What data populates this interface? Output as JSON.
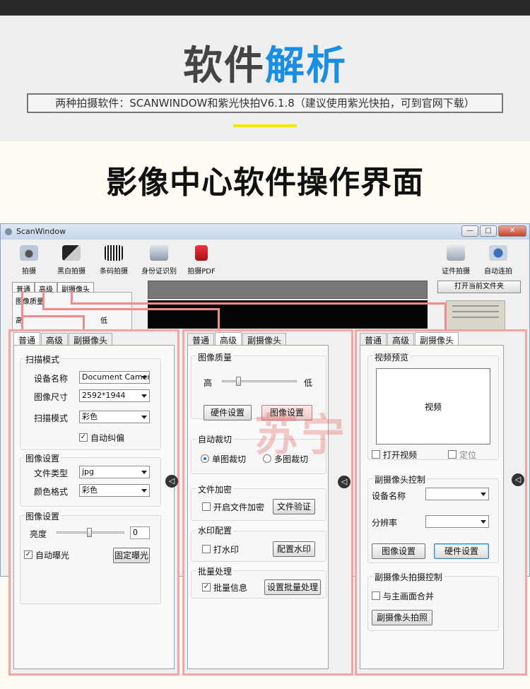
{
  "header": {
    "title_part1": "软件",
    "title_part2": "解析",
    "subtitle": "两种拍摄软件：SCANWINDOW和紫光快拍V6.1.8（建议使用紫光快拍，可到官网下载）",
    "section_title": "影像中心软件操作界面"
  },
  "app": {
    "title": "ScanWindow",
    "window_controls": [
      "—",
      "□",
      "✕"
    ],
    "tools": [
      {
        "label": "拍摄",
        "icon": "camera-icon"
      },
      {
        "label": "黑白拍摄",
        "icon": "bw-camera-icon"
      },
      {
        "label": "条码拍摄",
        "icon": "barcode-icon"
      },
      {
        "label": "身份证识别",
        "icon": "id-card-icon"
      },
      {
        "label": "拍摄PDF",
        "icon": "pdf-icon"
      },
      {
        "label": "证件拍摄",
        "icon": "certificate-icon"
      },
      {
        "label": "自动连拍",
        "icon": "burst-icon"
      }
    ],
    "tabs": [
      "普通",
      "高级",
      "副摄像头"
    ],
    "left_group_title": "图像质量",
    "left_high": "高",
    "left_low": "低",
    "open_folder_button": "打开当前文件夹"
  },
  "panel_left": {
    "tabs": [
      "普通",
      "高级",
      "副摄像头"
    ],
    "scan_mode": {
      "title": "扫描模式",
      "device_label": "设备名称",
      "device_value": "Document Camer",
      "size_label": "图像尺寸",
      "size_value": "2592*1944",
      "mode_label": "扫描模式",
      "mode_value": "彩色",
      "auto_deskew_label": "自动纠偏"
    },
    "image_settings": {
      "title": "图像设置",
      "file_type_label": "文件类型",
      "file_type_value": "jpg",
      "color_format_label": "颜色格式",
      "color_format_value": "彩色"
    },
    "image_settings2": {
      "title": "图像设置",
      "brightness_label": "亮度",
      "brightness_value": "0",
      "auto_exposure_label": "自动曝光",
      "fixed_exposure_button": "固定曝光"
    }
  },
  "panel_mid": {
    "tabs": [
      "普通",
      "高级",
      "副摄像头"
    ],
    "quality": {
      "title": "图像质量",
      "high": "高",
      "low": "低",
      "hardware_button": "硬件设置",
      "image_button": "图像设置"
    },
    "auto_crop": {
      "title": "自动裁切",
      "single": "单图裁切",
      "multi": "多图裁切"
    },
    "encrypt": {
      "title": "文件加密",
      "enable_label": "开启文件加密",
      "verify_button": "文件验证"
    },
    "watermark": {
      "title": "水印配置",
      "enable_label": "打水印",
      "config_button": "配置水印"
    },
    "batch": {
      "title": "批量处理",
      "info_label": "批量信息",
      "setup_button": "设置批量处理"
    }
  },
  "panel_right": {
    "tabs": [
      "普通",
      "高级",
      "副摄像头"
    ],
    "preview": {
      "title": "视频预览",
      "video_text": "视频",
      "open_video_label": "打开视频",
      "position_label": "定位"
    },
    "control": {
      "title": "副摄像头控制",
      "device_label": "设备名称",
      "resolution_label": "分辨率",
      "image_button": "图像设置",
      "hardware_button": "硬件设置"
    },
    "capture": {
      "title": "副摄像头拍摄控制",
      "merge_label": "与主画面合并",
      "capture_button": "副摄像头拍照"
    }
  },
  "watermark_text": "苏宁",
  "nav_arrow": "◁",
  "colors": {
    "accent_blue": "#1a8ee3",
    "highlight_pink": "#f4a4a4",
    "yellow": "#f5e800"
  }
}
